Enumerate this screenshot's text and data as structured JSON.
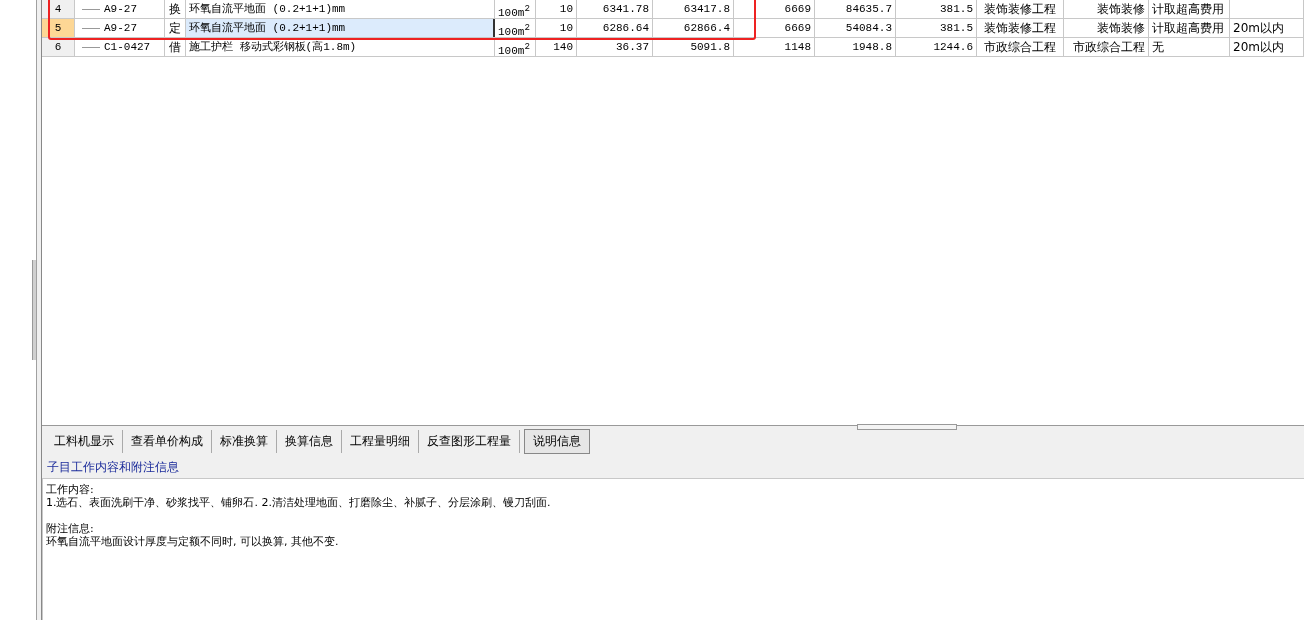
{
  "table": {
    "rows": [
      {
        "selected": false,
        "cells": [
          "4",
          "A9-27",
          "换",
          "环氧自流平地面 (0.2+1+1)mm",
          "100m$^{2}$",
          "10",
          "6341.78",
          "63417.8",
          "6669",
          "84635.7",
          "381.5",
          "装饰装修工程",
          "装饰装修",
          "计取超高费用",
          ""
        ]
      },
      {
        "selected": true,
        "cells": [
          "5",
          "A9-27",
          "定",
          "环氧自流平地面 (0.2+1+1)mm",
          "100m$^{2}$",
          "10",
          "6286.64",
          "62866.4",
          "6669",
          "54084.3",
          "381.5",
          "装饰装修工程",
          "装饰装修",
          "计取超高费用",
          "20m以内"
        ]
      },
      {
        "selected": false,
        "cells": [
          "6",
          "C1-0427",
          "借",
          "施工护栏 移动式彩钢板(高1.8m)",
          "100m$^{2}$",
          "140",
          "36.37",
          "5091.8",
          "1148",
          "1948.8",
          "1244.6",
          "市政综合工程",
          "市政综合工程",
          "无",
          "20m以内"
        ]
      }
    ]
  },
  "tabs": [
    {
      "label": "工料机显示",
      "selected": false
    },
    {
      "label": "查看单价构成",
      "selected": false
    },
    {
      "label": "标准换算",
      "selected": false
    },
    {
      "label": "换算信息",
      "selected": false
    },
    {
      "label": "工程量明细",
      "selected": false
    },
    {
      "label": "反查图形工程量",
      "selected": false
    },
    {
      "label": "说明信息",
      "selected": true
    }
  ],
  "info_panel": {
    "title": "子目工作内容和附注信息",
    "lines": [
      "工作内容:",
      "1.选石、表面洗刷干净、砂浆找平、铺卵石. 2.清洁处理地面、打磨除尘、补腻子、分层涂刷、镘刀刮面.",
      "附注信息:",
      "环氧自流平地面设计厚度与定额不同时, 可以换算, 其他不变."
    ]
  }
}
